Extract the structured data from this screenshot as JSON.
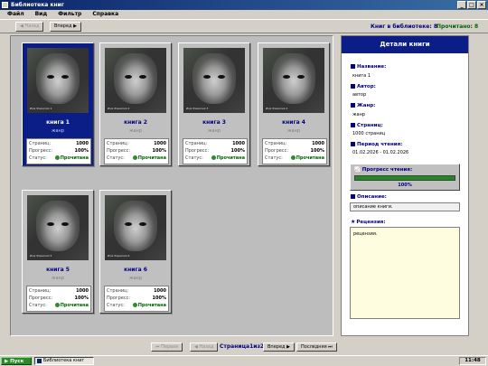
{
  "window": {
    "title": "Библиотека книг"
  },
  "menu": [
    "Файл",
    "Вид",
    "Фильтр",
    "Справка"
  ],
  "toolbar": {
    "back_label": "◀ Назад",
    "forward_label": "Вперед ▶",
    "books_in_library": "Книг в библиотеке: 8",
    "read_count": "Прочитано: 8"
  },
  "card_labels": {
    "pages": "Страниц:",
    "progress": "Прогресс:",
    "status": "Статус:"
  },
  "books": [
    {
      "title": "книга 1",
      "genre": "жанр",
      "pages": "1000",
      "progress": "100%",
      "status": "Прочитана",
      "cover_caption": "Имя Фамилия 1",
      "selected": true
    },
    {
      "title": "книга 2",
      "genre": "жанр",
      "pages": "1000",
      "progress": "100%",
      "status": "Прочитана",
      "cover_caption": "Имя Фамилия 2",
      "selected": false
    },
    {
      "title": "книга 3",
      "genre": "жанр",
      "pages": "1000",
      "progress": "100%",
      "status": "Прочитана",
      "cover_caption": "Имя Фамилия 3",
      "selected": false
    },
    {
      "title": "книга 4",
      "genre": "жанр",
      "pages": "1000",
      "progress": "100%",
      "status": "Прочитана",
      "cover_caption": "Имя Фамилия 4",
      "selected": false
    },
    {
      "title": "книга 5",
      "genre": "жанр",
      "pages": "1000",
      "progress": "100%",
      "status": "Прочитана",
      "cover_caption": "Имя Фамилия 5",
      "selected": false
    },
    {
      "title": "книга 6",
      "genre": "жанр",
      "pages": "1000",
      "progress": "100%",
      "status": "Прочитана",
      "cover_caption": "Имя Фамилия 6",
      "selected": false
    }
  ],
  "details": {
    "header": "Детали книги",
    "name_label": "Название:",
    "name_value": "книга 1",
    "author_label": "Автор:",
    "author_value": "автор",
    "genre_label": "Жанр:",
    "genre_value": "жанр",
    "pages_label": "Страниц:",
    "pages_value": "1000 страниц",
    "period_label": "Период чтения:",
    "period_value": "01.02.2026 - 01.02.2026",
    "progress_label": "Прогресс чтения:",
    "progress_text": "100%",
    "progress_fraction": 1.0,
    "description_label": "Описание:",
    "description_value": "описание книги.",
    "review_label": "Рецензия:",
    "review_value": "рецензия."
  },
  "pager": {
    "first_label": "⏮ Первая",
    "prev_label": "◀ Назад",
    "page_text": "Страница1из2",
    "next_label": "Вперед ▶",
    "last_label": "Последняя ⏭"
  },
  "taskbar": {
    "start_label": "▶ Пуск",
    "task_label": "Библиотека книг",
    "clock": "11:48"
  },
  "colors": {
    "selected_card": "#0b1d87",
    "accent_blue": "#000080",
    "status_green": "#006400",
    "progress_green": "#1f8a1f"
  }
}
